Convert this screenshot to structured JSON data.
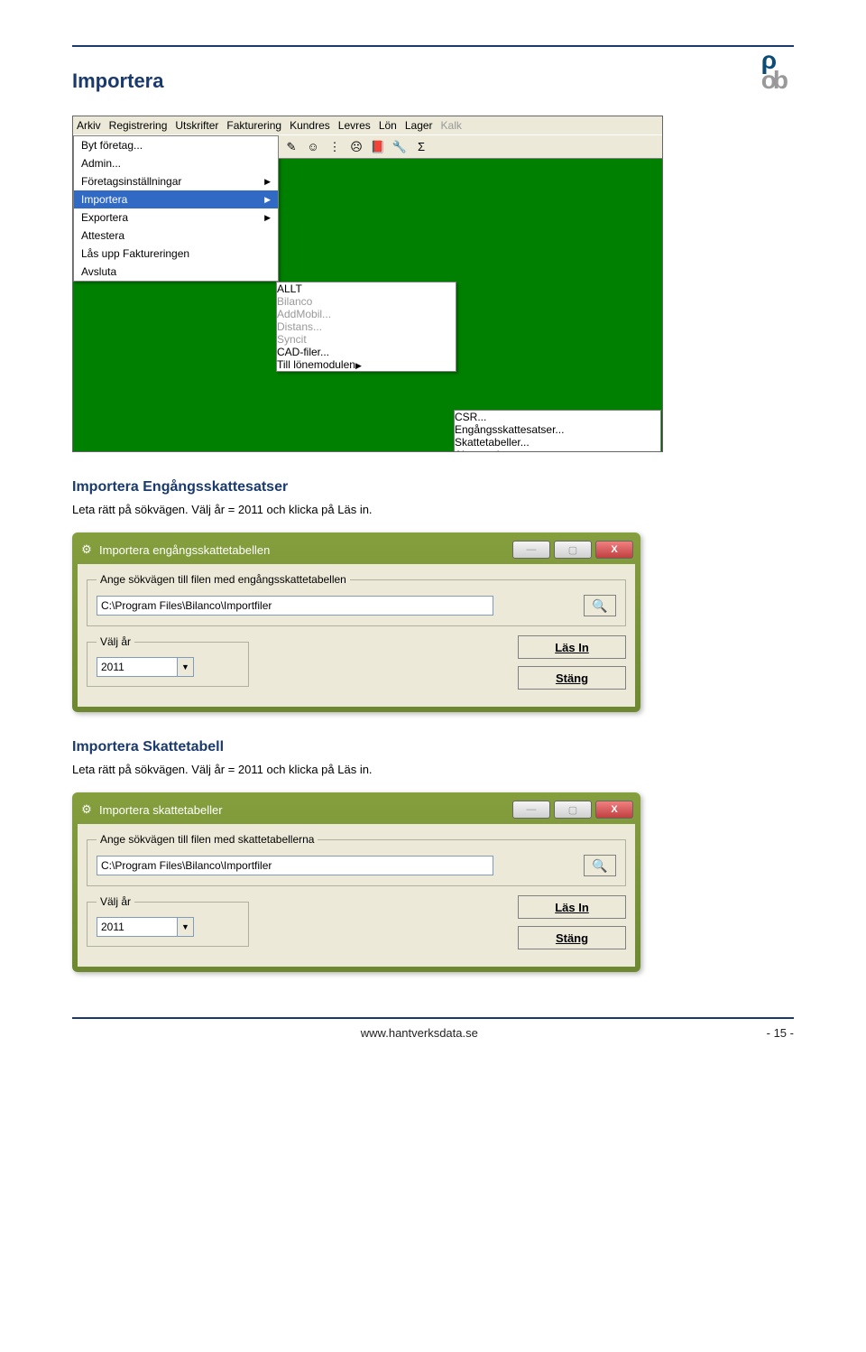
{
  "doc": {
    "h1": "Importera",
    "sub_engang": "Importera Engångsskattesatser",
    "sub_skatt": "Importera Skattetabell",
    "paragraph": "Leta rätt på sökvägen. Välj år = 2011 och klicka på Läs in."
  },
  "menu": {
    "bar": [
      "Arkiv",
      "Registrering",
      "Utskrifter",
      "Fakturering",
      "Kundres",
      "Levres",
      "Lön",
      "Lager"
    ],
    "bar_dim": "Kalk",
    "file_items": [
      {
        "label": "Byt företag...",
        "arrow": false,
        "hl": false
      },
      {
        "label": "Admin...",
        "arrow": false,
        "hl": false
      },
      {
        "label": "Företagsinställningar",
        "arrow": true,
        "hl": false
      },
      {
        "label": "Importera",
        "arrow": true,
        "hl": true
      },
      {
        "label": "Exportera",
        "arrow": true,
        "hl": false
      },
      {
        "label": "Attestera",
        "arrow": false,
        "hl": false
      },
      {
        "label": "Lås upp Faktureringen",
        "arrow": false,
        "hl": false
      },
      {
        "label": "Avsluta",
        "arrow": false,
        "hl": false
      }
    ],
    "sub1": [
      {
        "label": "ALLT",
        "dim": false,
        "arrow": false,
        "hl": false
      },
      {
        "label": "Bilanco",
        "dim": true,
        "arrow": false,
        "hl": false
      },
      {
        "label": "AddMobil...",
        "dim": true,
        "arrow": false,
        "hl": false
      },
      {
        "label": "Distans...",
        "dim": true,
        "arrow": false,
        "hl": false
      },
      {
        "label": "Syncit",
        "dim": true,
        "arrow": false,
        "hl": false
      },
      {
        "label": "CAD-filer...",
        "dim": false,
        "arrow": false,
        "hl": false
      },
      {
        "label": "Till lönemodulen",
        "dim": false,
        "arrow": true,
        "hl": true
      }
    ],
    "sub2": [
      "CSR...",
      "Engångsskattesatser...",
      "Skattetabeller...",
      "Almanacka..."
    ],
    "toolbar_icons": [
      "✎",
      "☺",
      "⋮",
      "☹",
      "📕",
      "🔧",
      "Σ"
    ]
  },
  "dialog_engang": {
    "title": "Importera engångsskattetabellen",
    "group_label": "Ange sökvägen till filen med engångsskattetabellen",
    "path": "C:\\Program Files\\Bilanco\\Importfiler",
    "year_label": "Välj år",
    "year_value": "2011",
    "btn_read": "Läs In",
    "btn_close": "Stäng"
  },
  "dialog_skatt": {
    "title": "Importera skattetabeller",
    "group_label": "Ange sökvägen till filen med skattetabellerna",
    "path": "C:\\Program Files\\Bilanco\\Importfiler",
    "year_label": "Välj år",
    "year_value": "2011",
    "btn_read": "Läs In",
    "btn_close": "Stäng"
  },
  "footer": {
    "url": "www.hantverksdata.se",
    "page": "- 15 -"
  }
}
